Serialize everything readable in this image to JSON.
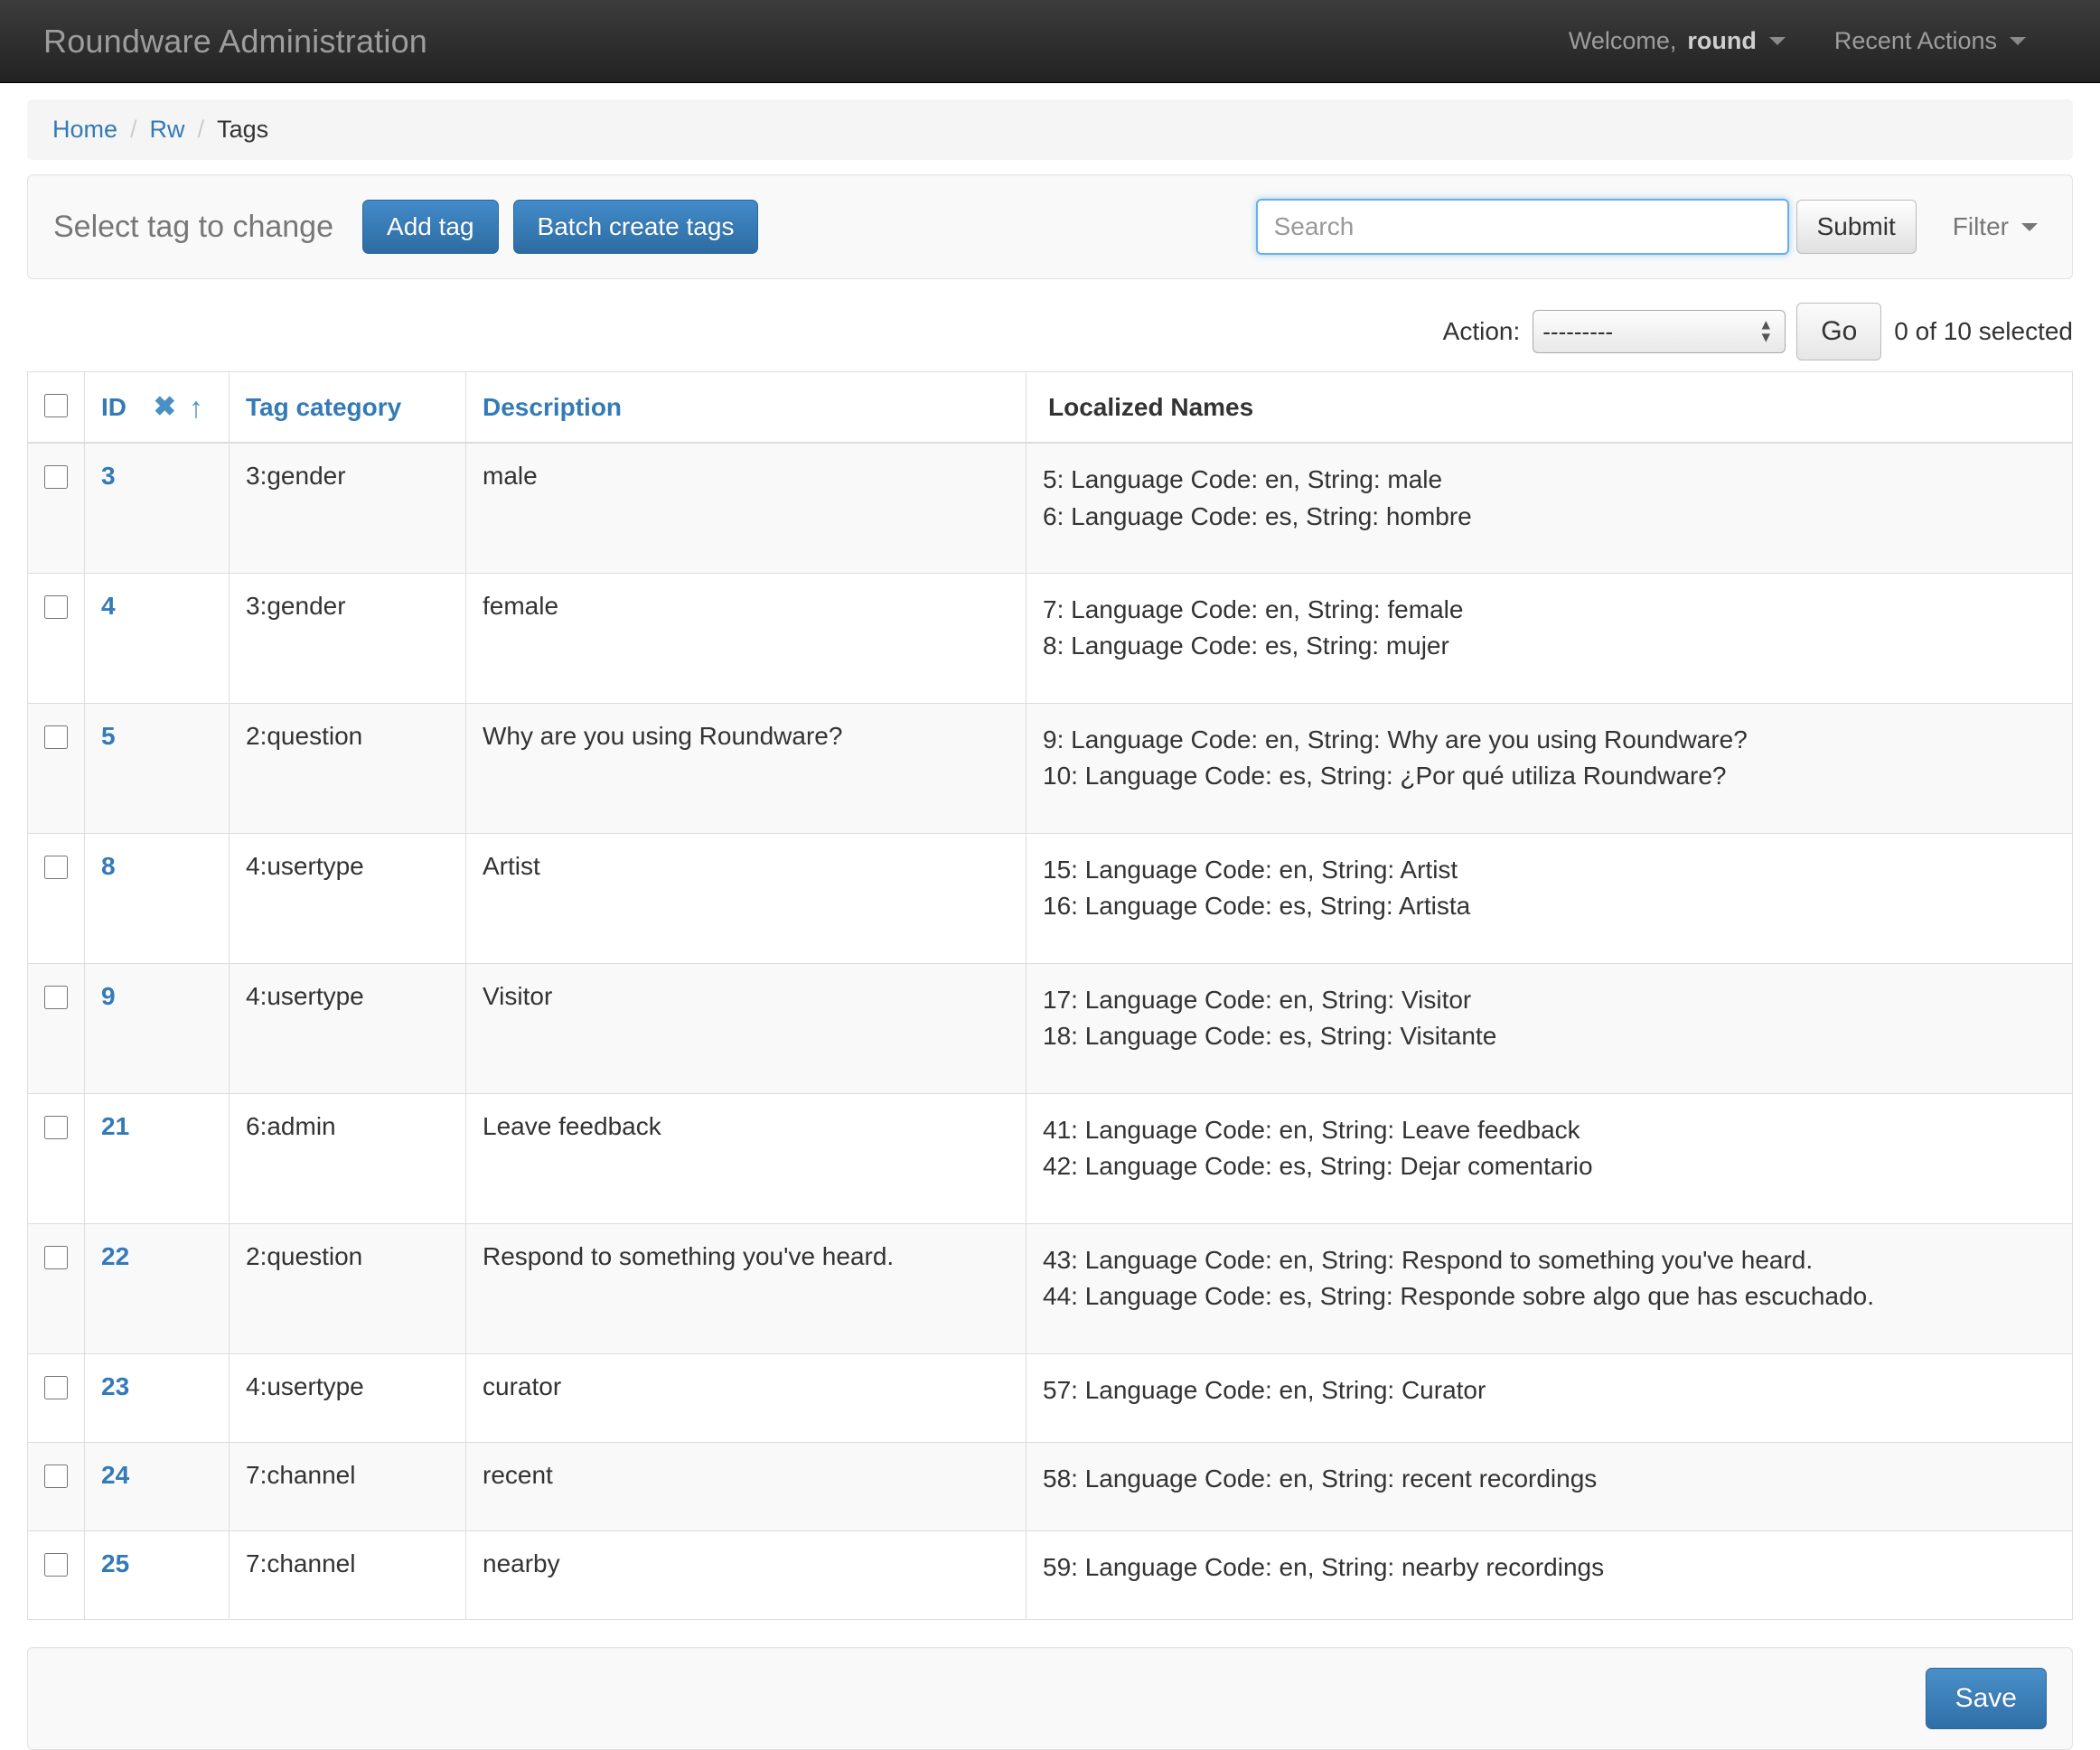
{
  "header": {
    "brand": "Roundware Administration",
    "welcome_prefix": "Welcome,",
    "username": "round",
    "recent_actions": "Recent Actions"
  },
  "breadcrumb": {
    "home": "Home",
    "app": "Rw",
    "current": "Tags",
    "separator": "/"
  },
  "toolbar": {
    "title": "Select tag to change",
    "add_tag": "Add tag",
    "batch_create": "Batch create tags",
    "search_placeholder": "Search",
    "search_value": "",
    "submit": "Submit",
    "filter": "Filter"
  },
  "actions": {
    "label": "Action:",
    "selected_option": "---------",
    "options": [
      "---------"
    ],
    "go": "Go",
    "selection_counter": "0 of 10 selected"
  },
  "table": {
    "columns": {
      "id": "ID",
      "tag_category": "Tag category",
      "description": "Description",
      "localized_names": "Localized Names"
    },
    "sort_remove_icon": "✖",
    "sort_asc_icon": "↑",
    "rows": [
      {
        "id": "3",
        "tag_category": "3:gender",
        "description": "male",
        "localized_names": [
          "5: Language Code: en, String: male",
          "6: Language Code: es, String: hombre"
        ]
      },
      {
        "id": "4",
        "tag_category": "3:gender",
        "description": "female",
        "localized_names": [
          "7: Language Code: en, String: female",
          "8: Language Code: es, String: mujer"
        ]
      },
      {
        "id": "5",
        "tag_category": "2:question",
        "description": "Why are you using Roundware?",
        "localized_names": [
          "9: Language Code: en, String: Why are you using Roundware?",
          "10: Language Code: es, String: ¿Por qué utiliza Roundware?"
        ]
      },
      {
        "id": "8",
        "tag_category": "4:usertype",
        "description": "Artist",
        "localized_names": [
          "15: Language Code: en, String: Artist",
          "16: Language Code: es, String: Artista"
        ]
      },
      {
        "id": "9",
        "tag_category": "4:usertype",
        "description": "Visitor",
        "localized_names": [
          "17: Language Code: en, String: Visitor",
          "18: Language Code: es, String: Visitante"
        ]
      },
      {
        "id": "21",
        "tag_category": "6:admin",
        "description": "Leave feedback",
        "localized_names": [
          "41: Language Code: en, String: Leave feedback",
          "42: Language Code: es, String: Dejar comentario"
        ]
      },
      {
        "id": "22",
        "tag_category": "2:question",
        "description": "Respond to something you've heard.",
        "localized_names": [
          "43: Language Code: en, String: Respond to something you've heard.",
          "44: Language Code: es, String: Responde sobre algo que has escuchado."
        ]
      },
      {
        "id": "23",
        "tag_category": "4:usertype",
        "description": "curator",
        "localized_names": [
          "57: Language Code: en, String: Curator"
        ]
      },
      {
        "id": "24",
        "tag_category": "7:channel",
        "description": "recent",
        "localized_names": [
          "58: Language Code: en, String: recent recordings"
        ]
      },
      {
        "id": "25",
        "tag_category": "7:channel",
        "description": "nearby",
        "localized_names": [
          "59: Language Code: en, String: nearby recordings"
        ]
      }
    ]
  },
  "footer": {
    "save": "Save"
  },
  "colors": {
    "brand_bar": "#2b2b2b",
    "link": "#337ab7",
    "primary_button": "#428bca",
    "focus_ring": "#66afe9"
  }
}
